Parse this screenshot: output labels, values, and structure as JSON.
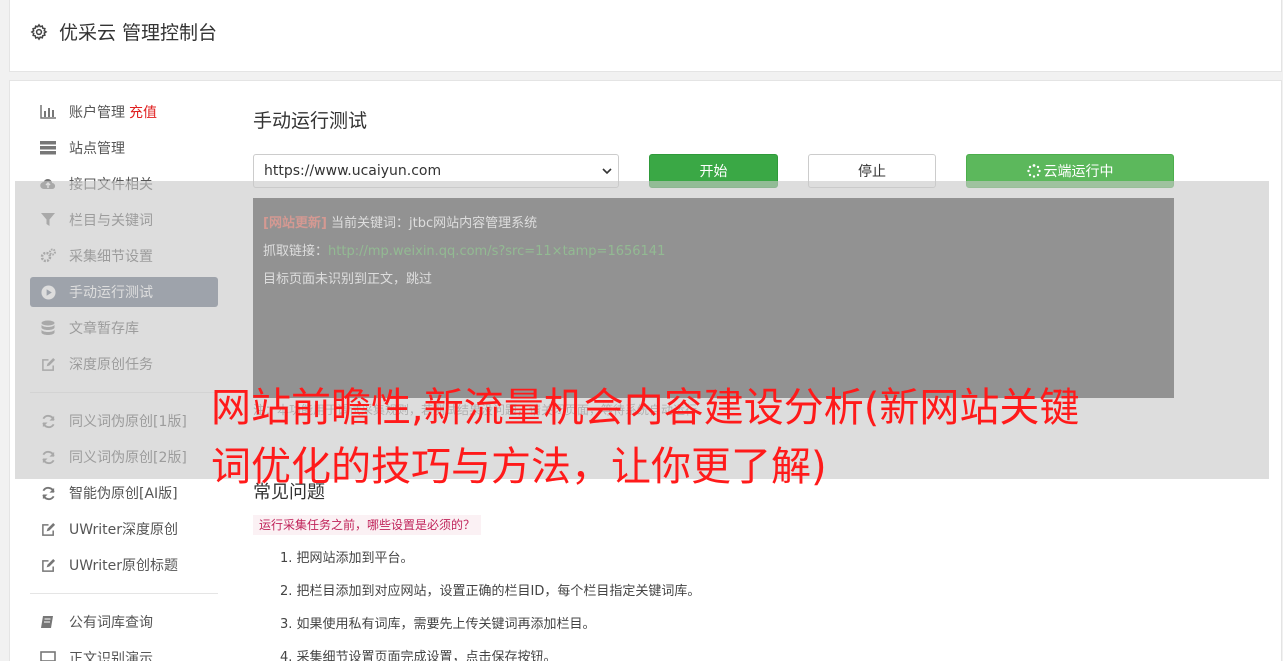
{
  "header": {
    "title": "优采云 管理控制台"
  },
  "sidebar": {
    "items": [
      {
        "label": "账户管理",
        "icon": "bar-chart-icon",
        "badge": "充值"
      },
      {
        "label": "站点管理",
        "icon": "server-icon"
      },
      {
        "label": "接口文件相关",
        "icon": "cloud-upload-icon"
      },
      {
        "label": "栏目与关键词",
        "icon": "filter-icon"
      },
      {
        "label": "采集细节设置",
        "icon": "gears-icon"
      },
      {
        "label": "手动运行测试",
        "icon": "play-circle-icon",
        "active": true
      },
      {
        "label": "文章暂存库",
        "icon": "database-icon"
      },
      {
        "label": "深度原创任务",
        "icon": "edit-icon"
      },
      {
        "label": "同义词伪原创[1版]",
        "icon": "refresh-icon"
      },
      {
        "label": "同义词伪原创[2版]",
        "icon": "refresh-icon"
      },
      {
        "label": "智能伪原创[AI版]",
        "icon": "refresh-icon"
      },
      {
        "label": "UWriter深度原创",
        "icon": "edit-icon"
      },
      {
        "label": "UWriter原创标题",
        "icon": "edit-icon"
      },
      {
        "label": "公有词库查询",
        "icon": "book-icon"
      },
      {
        "label": "正文识别演示",
        "icon": "monitor-icon"
      }
    ]
  },
  "main": {
    "title": "手动运行测试",
    "site_select": {
      "value": "https://www.ucaiyun.com"
    },
    "buttons": {
      "start": "开始",
      "stop": "停止",
      "cloud": "云端运行中"
    },
    "console": {
      "tag": "[网站更新]",
      "line1": "当前关键词：jtbc网站内容管理系统",
      "line2_label": "抓取链接：",
      "line2_link": "http://mp.weixin.qq.com/s?src=11×tamp=1656141",
      "line3": "目标页面未识别到正文，跳过"
    },
    "hint": "注：本功能用于调试采集规则，若测试结果没问题，请关闭页面，等待系统自动运行",
    "faq": {
      "title": "常见问题",
      "question": "运行采集任务之前，哪些设置是必须的？",
      "steps": [
        "1. 把网站添加到平台。",
        "2. 把栏目添加到对应网站，设置正确的栏目ID，每个栏目指定关键词库。",
        "3. 如果使用私有词库，需要先上传关键词再添加栏目。",
        "4. 采集细节设置页面完成设置，点击保存按钮。"
      ]
    }
  },
  "overlay_title": "网站前瞻性,新流量机会内容建设分析(新网站关键词优化的技巧与方法，让你更了解)",
  "colors": {
    "accent_green": "#3aa845",
    "active_nav": "#59687d",
    "overlay_red": "#ff1a1a"
  }
}
